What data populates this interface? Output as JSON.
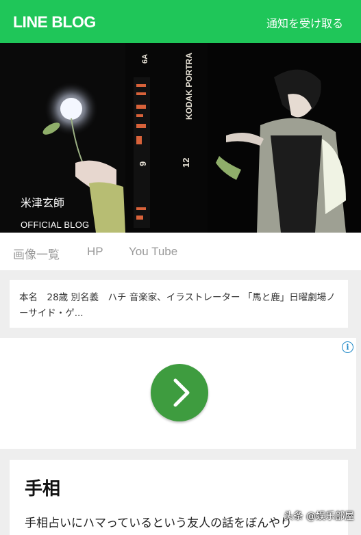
{
  "header": {
    "logo": "LINE BLOG",
    "notify_label": "通知を受け取る"
  },
  "hero": {
    "name": "米津玄師",
    "subtitle": "OFFICIAL BLOG",
    "film_text": [
      "6A",
      "KODAK PORTRA",
      "12"
    ]
  },
  "nav": {
    "tabs": [
      {
        "label": "画像一覧"
      },
      {
        "label": "HP"
      },
      {
        "label": "You Tube"
      }
    ]
  },
  "profile": {
    "text": "本名　28歳 別名義　ハチ 音楽家、イラストレーター 「馬と鹿」日曜劇場ノーサイド・ゲ..."
  },
  "ad": {
    "info_icon": "i"
  },
  "article": {
    "title": "手相",
    "excerpt": "手相占いにハマっているという友人の話をぼんやり"
  },
  "watermark": "头条 @娱乐部屋",
  "colors": {
    "brand_green": "#1fc659",
    "ad_button": "#3e9c3f",
    "info_blue": "#1e88c7"
  }
}
